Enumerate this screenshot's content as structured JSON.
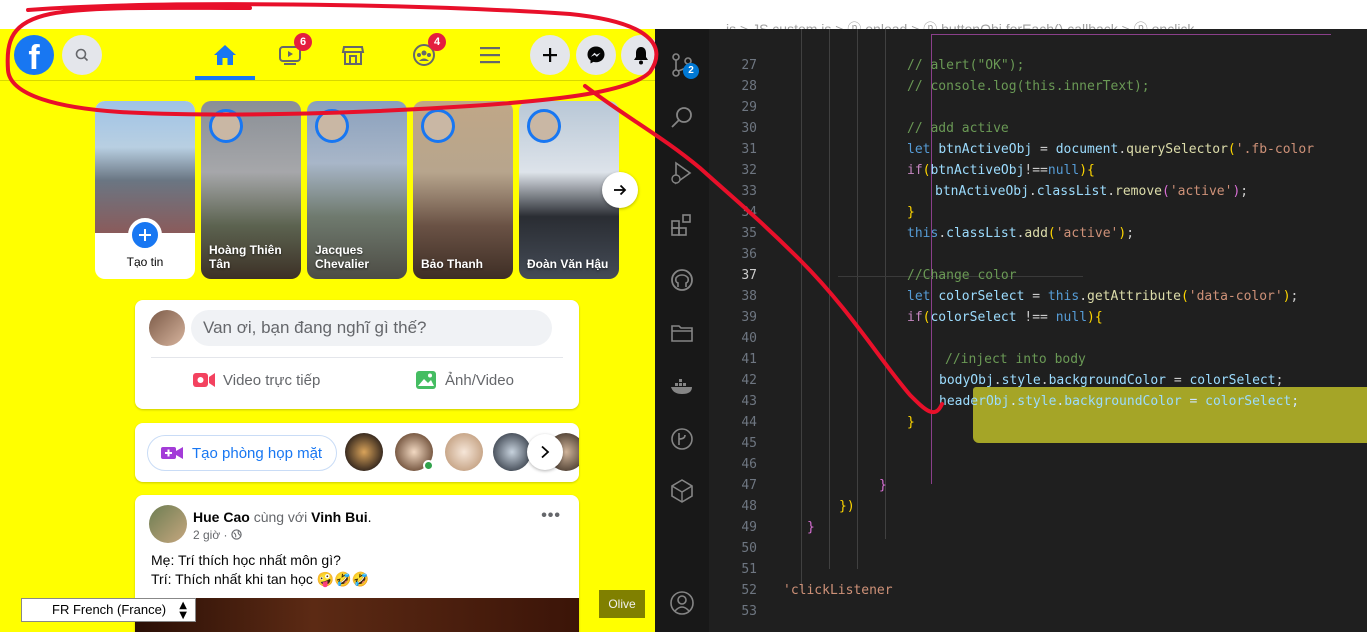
{
  "breadcrumb": {
    "text": "js > JS custom.js > ⓟ onload > ⓟ buttonObj.forEach() callback > ⓟ onclick"
  },
  "facebook": {
    "header": {
      "watch_badge": "6",
      "groups_badge": "4"
    },
    "stories": [
      {
        "name": "Tạo tin",
        "type": "create"
      },
      {
        "name": "Hoàng Thiên Tân"
      },
      {
        "name": "Jacques Chevalier"
      },
      {
        "name": "Bảo Thanh"
      },
      {
        "name": "Đoàn Văn Hậu"
      }
    ],
    "composer": {
      "placeholder": "Van ơi, bạn đang nghĩ gì thế?",
      "live_label": "Video trực tiếp",
      "photo_label": "Ảnh/Video"
    },
    "rooms": {
      "button_label": "Tạo phòng họp mặt"
    },
    "post": {
      "author": "Hue Cao",
      "with_text": "cùng với",
      "tagged": "Vinh Bui",
      "time": "2 giờ · ",
      "more": "•••",
      "lines": [
        "Mẹ: Trí thích học nhất môn gì?",
        "Trí: Thích nhất khi tan học 🤪🤣🤣"
      ]
    },
    "language_select": "FR French (France)",
    "olive_button": "Olive",
    "colors": {
      "background": "#ffff00",
      "brand": "#1877f2",
      "badge": "#e41e3f"
    }
  },
  "editor": {
    "line_numbers": [
      "27",
      "28",
      "29",
      "30",
      "31",
      "32",
      "33",
      "34",
      "35",
      "36",
      "37",
      "38",
      "39",
      "40",
      "41",
      "42",
      "43",
      "44",
      "45",
      "46",
      "47",
      "48",
      "49",
      "50",
      "51",
      "52",
      "53"
    ],
    "active_line": "37",
    "code": {
      "l27": "// alert(\"OK\");",
      "l28": "// console.log(this.innerText);",
      "l30": "// add active",
      "l31_kw": "let",
      "l31_var": "btnActiveObj",
      "l31_eq": " = ",
      "l31_obj": "document",
      "l31_fn": "querySelector",
      "l31_str": "'.fb-color",
      "l32_if": "if",
      "l32_rest": "btnActiveObj",
      "l32_op": "!==",
      "l32_null": "null",
      "l33_obj": "btnActiveObj",
      "l33_prop": "classList",
      "l33_fn": "remove",
      "l33_str": "'active'",
      "l35_this": "this",
      "l35_prop": "classList",
      "l35_fn": "add",
      "l35_str": "'active'",
      "l37": "//Change color",
      "l38_kw": "let",
      "l38_var": "colorSelect",
      "l38_this": "this",
      "l38_fn": "getAttribute",
      "l38_str": "'data-color'",
      "l39_if": "if",
      "l39_var": "colorSelect",
      "l39_op": " !== ",
      "l39_null": "null",
      "l41": "//inject into body",
      "l42_obj": "bodyObj",
      "l42_prop1": "style",
      "l42_prop2": "backgroundColor",
      "l42_val": "colorSelect",
      "l43_obj": "headerObj",
      "l43_prop1": "style",
      "l43_prop2": "backgroundColor",
      "l43_val": "colorSelect",
      "l48": "})",
      "l49": "}",
      "l52": "'clickListener"
    },
    "activity_badge": "2",
    "colors": {
      "background": "#1f1f1f",
      "comment": "#6a9955",
      "keyword": "#569cd6",
      "string": "#ce9178",
      "highlight": "#b4b428"
    }
  }
}
